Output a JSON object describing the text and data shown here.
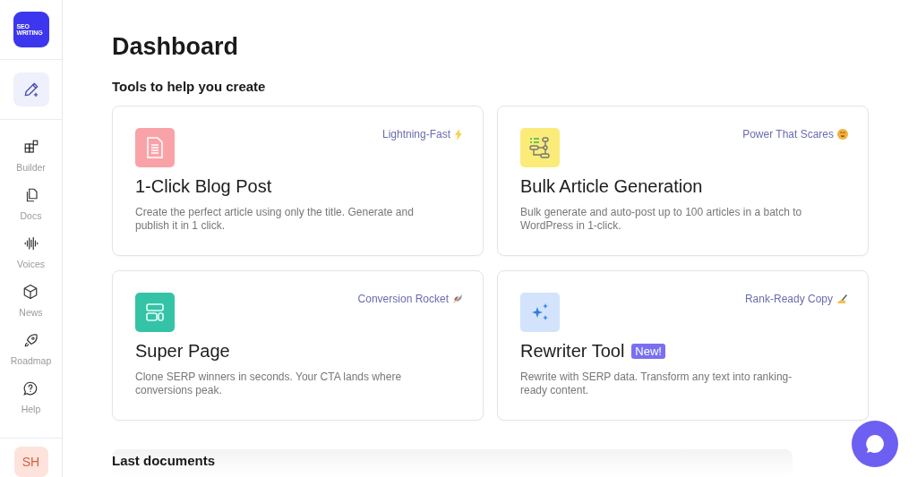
{
  "sidebar": {
    "logo": "SEO WRITING",
    "nav": [
      {
        "label": "Builder"
      },
      {
        "label": "Docs"
      },
      {
        "label": "Voices"
      },
      {
        "label": "News"
      },
      {
        "label": "Roadmap"
      },
      {
        "label": "Help"
      }
    ],
    "avatar": "SH"
  },
  "page": {
    "title": "Dashboard",
    "subtitle": "Tools to help you create"
  },
  "tools": [
    {
      "tag": "Lightning-Fast",
      "title": "1-Click Blog Post",
      "description": "Create the perfect article using only the title. Generate and publish it in 1 click."
    },
    {
      "tag": "Power That Scares",
      "title": "Bulk Article Generation",
      "description": "Bulk generate and auto-post up to 100 articles in a batch to WordPress in 1-click."
    },
    {
      "tag": "Conversion Rocket",
      "title": "Super Page",
      "description": "Clone SERP winners in seconds. Your CTA lands where conversions peak."
    },
    {
      "tag": "Rank-Ready Copy",
      "title": "Rewriter Tool",
      "badge": "New!",
      "description": "Rewrite with SERP data. Transform any text into ranking-ready content."
    }
  ],
  "last_documents": {
    "heading": "Last documents"
  }
}
